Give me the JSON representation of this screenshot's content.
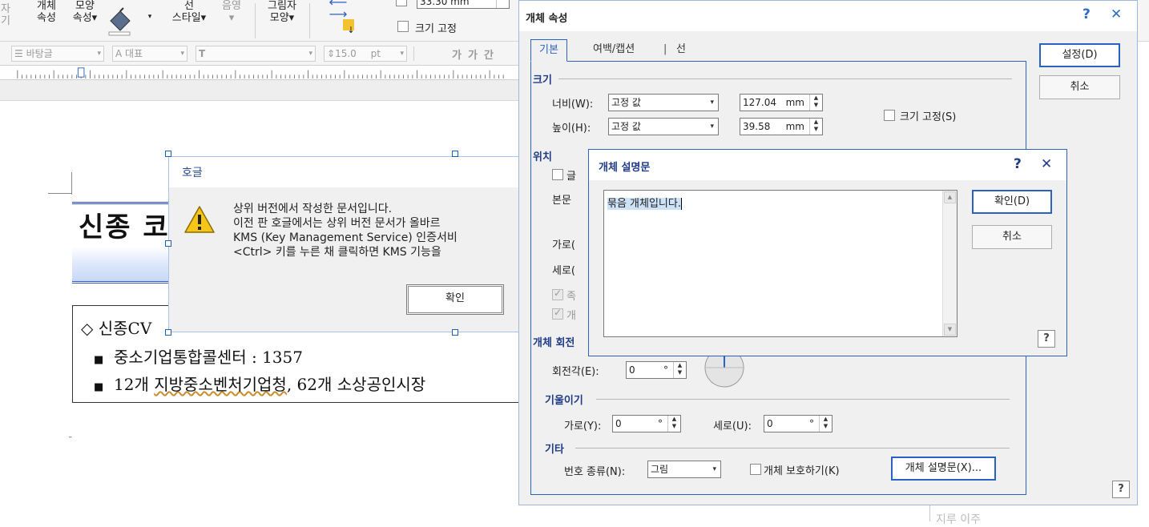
{
  "ribbon": {
    "object_props": [
      "개체",
      "속성"
    ],
    "shape_props": [
      "모양",
      "속성▾"
    ],
    "line_style": [
      "선",
      "스타일▾"
    ],
    "shade": "음영",
    "shadow_shape": [
      "그림자",
      "모양▾"
    ],
    "size_value": "33.30  mm",
    "fix_size": "크기 고정",
    "style_combo": "바탕글",
    "rep_combo": "대표",
    "font_size": "15.0",
    "font_unit": "pt",
    "bold_glyphs": [
      "가",
      "가",
      "간"
    ]
  },
  "document": {
    "title": "신종 코",
    "bullet_top": "◇ 신종CV",
    "bullet1": "중소기업통합콜센터 : 1357",
    "bullet2_prefix": "12개 ",
    "bullet2_underlined": "지방중소벤처기업청",
    "bullet2_suffix": ", 62개 소상공인시장",
    "mark": "˵"
  },
  "msgbox": {
    "title": "호글",
    "lines": [
      "상위 버전에서 작성한 문서입니다.",
      "이전 판 호글에서는 상위 버전 문서가 올바르",
      "KMS (Key Management Service) 인증서비",
      "<Ctrl> 키를 누른 채 클릭하면 KMS 기능을"
    ],
    "ok_label": "확인"
  },
  "props_dialog": {
    "title": "개체 속성",
    "help": "?",
    "close": "✕",
    "tabs": [
      "기본",
      "여백/캡션",
      "선"
    ],
    "ok_label": "설정(D)",
    "cancel_label": "취소",
    "size": {
      "section": "크기",
      "width_label": "너비(W):",
      "width_mode": "고정 값",
      "width_value": "127.04",
      "height_label": "높이(H):",
      "height_mode": "고정 값",
      "height_value": "39.58",
      "unit": "mm",
      "fix_size": "크기 고정(S)"
    },
    "position": {
      "section": "위치",
      "glyph1": "글",
      "body_label": "본문",
      "horiz_label": "가로(",
      "vert_label": "세로(",
      "opt1": "족",
      "opt2": "개"
    },
    "rotate": {
      "section": "개체 회전",
      "angle_label": "회전각(E):",
      "angle_value": "0",
      "degree": "°"
    },
    "skew": {
      "section": "기울이기",
      "horiz_label": "가로(Y):",
      "horiz_value": "0",
      "vert_label": "세로(U):",
      "vert_value": "0",
      "degree": "°"
    },
    "etc": {
      "section": "기타",
      "numbering_label": "번호 종류(N):",
      "numbering_value": "그림",
      "protect_label": "개체 보호하기(K)",
      "desc_button": "개체 설명문(X)..."
    },
    "bottom_help": "?"
  },
  "desc_dialog": {
    "title": "개체 설명문",
    "help": "?",
    "close": "✕",
    "text": "묶음 개체입니다.",
    "ok_label": "확인(D)",
    "cancel_label": "취소",
    "bottom_help": "?"
  },
  "ghost_text": "지루  이주"
}
